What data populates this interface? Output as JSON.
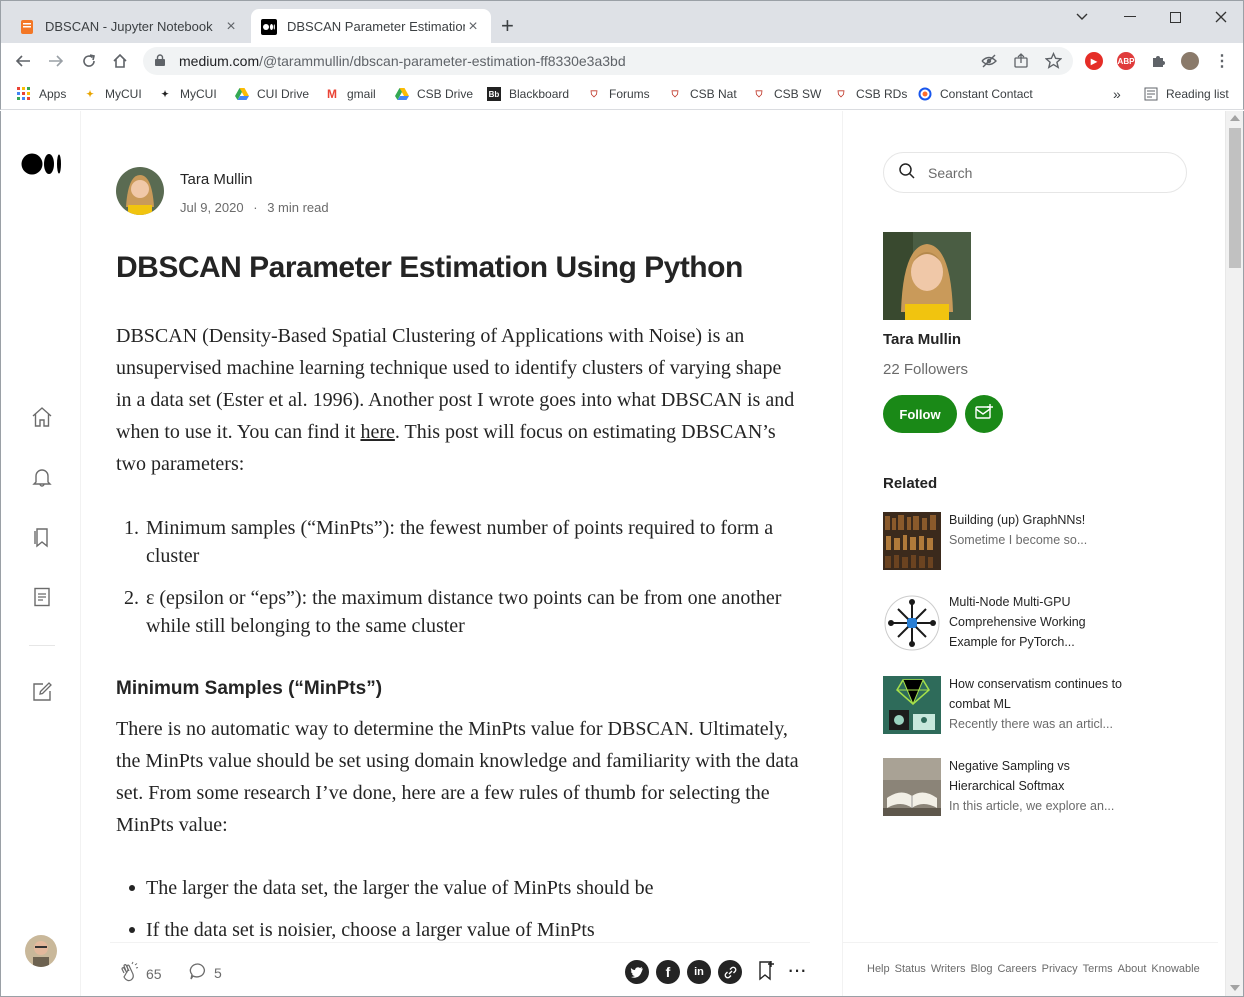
{
  "browser": {
    "tabs": [
      {
        "title": "DBSCAN - Jupyter Notebook",
        "favicon": "jupyter-icon"
      },
      {
        "title": "DBSCAN Parameter Estimation U",
        "favicon": "medium-icon"
      }
    ],
    "url_host": "medium.com",
    "url_path": "/@tarammullin/dbscan-parameter-estimation-ff8330e3a3bd",
    "bookmarks": [
      {
        "label": "Apps",
        "icon": "apps-grid-icon"
      },
      {
        "label": "MyCUI",
        "icon": "cui-icon"
      },
      {
        "label": "MyCUI",
        "icon": "cui-icon"
      },
      {
        "label": "CUI Drive",
        "icon": "drive-icon"
      },
      {
        "label": "gmail",
        "icon": "gmail-icon"
      },
      {
        "label": "CSB Drive",
        "icon": "drive-icon"
      },
      {
        "label": "Blackboard",
        "icon": "blackboard-icon"
      },
      {
        "label": "Forums",
        "icon": "shield-icon"
      },
      {
        "label": "CSB Nat",
        "icon": "shield-icon"
      },
      {
        "label": "CSB SW",
        "icon": "shield-icon"
      },
      {
        "label": "CSB RDs",
        "icon": "shield-icon"
      },
      {
        "label": "Constant Contact",
        "icon": "constant-contact-icon"
      }
    ],
    "more_bookmarks": "»",
    "reading_list": "Reading list"
  },
  "article": {
    "author": "Tara Mullin",
    "date": "Jul 9, 2020",
    "separator": "·",
    "read_time": "3 min read",
    "title": "DBSCAN Parameter Estimation Using Python",
    "p1_before_link": "DBSCAN (Density-Based Spatial Clustering of Applications with Noise) is an unsupervised machine learning technique used to identify clusters of varying shape in a data set (Ester et al. 1996). Another post I wrote goes into what DBSCAN is and when to use it. You can find it ",
    "p1_link": "here",
    "p1_after_link": ". This post will focus on estimating DBSCAN’s two parameters:",
    "list": [
      {
        "num": "1.",
        "text": "Minimum samples (“MinPts”): the fewest number of points required to form a cluster"
      },
      {
        "num": "2.",
        "text": "ε (epsilon or “eps”): the maximum distance two points can be from one another while still belonging to the same cluster"
      }
    ],
    "heading2": "Minimum Samples (“MinPts”)",
    "p2": "There is no automatic way to determine the MinPts value for DBSCAN. Ultimately, the MinPts value should be set using domain knowledge and familiarity with the data set. From some research I’ve done, here are a few rules of thumb for selecting the MinPts value:",
    "bullets": [
      "The larger the data set, the larger the value of MinPts should be",
      "If the data set is noisier, choose a larger value of MinPts"
    ],
    "claps": "65",
    "responses": "5"
  },
  "sidebar": {
    "search_placeholder": "Search",
    "author_name": "Tara Mullin",
    "followers": "22 Followers",
    "follow_label": "Follow",
    "related_heading": "Related",
    "related": [
      {
        "title": "Building (up) GraphNNs!",
        "snippet": "Sometime I become so..."
      },
      {
        "title": "Multi-Node Multi-GPU Comprehensive Working Example for PyTorch...",
        "snippet": ""
      },
      {
        "title": "How conservatism continues to combat ML",
        "snippet": "Recently there was an articl..."
      },
      {
        "title": "Negative Sampling vs Hierarchical Softmax",
        "snippet": "In this article, we explore an..."
      }
    ],
    "footer_links": [
      "Help",
      "Status",
      "Writers",
      "Blog",
      "Careers",
      "Privacy",
      "Terms",
      "About",
      "Knowable"
    ]
  },
  "colors": {
    "accent_green": "#1a8917",
    "text": "#242424",
    "muted": "#6b6b6b"
  }
}
